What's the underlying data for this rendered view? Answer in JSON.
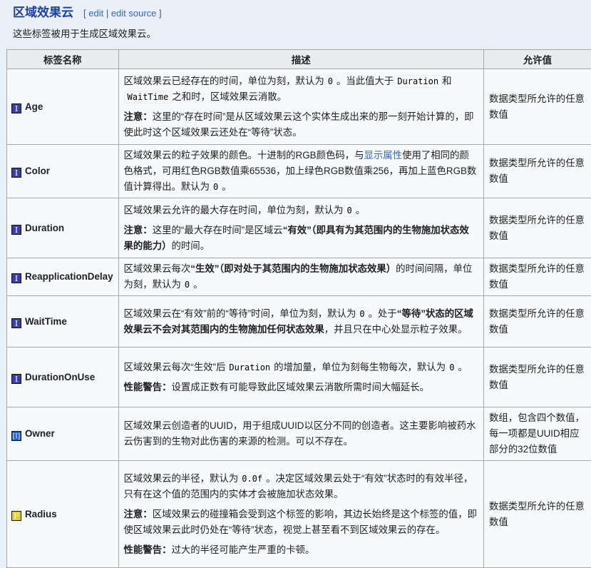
{
  "heading": {
    "title": "区域效果云",
    "edit_open": "[ ",
    "edit": "edit",
    "sep": " | ",
    "edit_source": "edit source",
    "edit_close": " ]"
  },
  "intro": "这些标签被用于生成区域效果云。",
  "table": {
    "headers": [
      "标签名称",
      "描述",
      "允许值"
    ],
    "rows": [
      {
        "icon": "int",
        "icon_glyph": "I",
        "name": "Age",
        "allowed": "数据类型所允许的任意数值",
        "desc": [
          [
            {
              "t": "区域效果云已经存在的时间，单位为刻，默认为"
            },
            {
              "code": "0"
            },
            {
              "t": "。当此值大于"
            },
            {
              "code": "Duration"
            },
            {
              "t": "和"
            },
            {
              "code": "WaitTime"
            },
            {
              "t": "之和时，区域效果云消散。"
            }
          ],
          [
            {
              "b": "注意："
            },
            {
              "t": "这里的“存在时间”是从区域效果云这个实体生成出来的那一刻开始计算的，即使此时这个区域效果云还处在“等待”状态。"
            }
          ]
        ]
      },
      {
        "icon": "int",
        "icon_glyph": "I",
        "name": "Color",
        "allowed": "数据类型所允许的任意数值",
        "desc": [
          [
            {
              "t": "区域效果云的粒子效果的颜色。十进制的RGB颜色码，与"
            },
            {
              "a": "显示属性"
            },
            {
              "t": "使用了相同的颜色格式，可用红色RGB数值乘65536，加上绿色RGB数值乘256，再加上蓝色RGB数值计算得出。默认为"
            },
            {
              "code": "0"
            },
            {
              "t": "。"
            }
          ]
        ]
      },
      {
        "icon": "int",
        "icon_glyph": "I",
        "name": "Duration",
        "allowed": "数据类型所允许的任意数值",
        "desc": [
          [
            {
              "t": "区域效果云允许的最大存在时间，单位为刻，默认为"
            },
            {
              "code": "0"
            },
            {
              "t": "。"
            }
          ],
          [
            {
              "b": "注意："
            },
            {
              "t": "这里的“最大存在时间”是区域云"
            },
            {
              "b": "“有效”（即具有为其范围内的生物施加状态效果的能力）"
            },
            {
              "t": "的时间。"
            }
          ]
        ]
      },
      {
        "icon": "int",
        "icon_glyph": "I",
        "name": "ReapplicationDelay",
        "allowed": "数据类型所允许的任意数值",
        "desc": [
          [
            {
              "t": "区域效果云每次"
            },
            {
              "b": "“生效”（即对处于其范围内的生物施加状态效果）"
            },
            {
              "t": "的时间间隔，单位为刻，默认为"
            },
            {
              "code": "0"
            },
            {
              "t": "。"
            }
          ]
        ]
      },
      {
        "icon": "int",
        "icon_glyph": "I",
        "name": "WaitTime",
        "allowed": "数据类型所允许的任意数值",
        "desc": [
          [
            {
              "t": "区域效果云在“有效”前的“等待”时间，单位为刻，默认为"
            },
            {
              "code": "0"
            },
            {
              "t": "。处于"
            },
            {
              "b": "“等待”状态的区域效果云不会对其范围内的生物施加任何状态效果"
            },
            {
              "t": "，并且只在中心处显示粒子效果。"
            }
          ]
        ]
      },
      {
        "icon": "int",
        "icon_glyph": "I",
        "name": "DurationOnUse",
        "allowed": "数据类型所允许的任意数值",
        "desc": [
          [
            {
              "t": "区域效果云每次“生效”后"
            },
            {
              "code": "Duration"
            },
            {
              "t": "的增加量，单位为刻每生物每次，默认为"
            },
            {
              "code": "0"
            },
            {
              "t": "。"
            }
          ],
          [
            {
              "b": "性能警告："
            },
            {
              "t": "设置成正数有可能导致此区域效果云消散所需时间大幅延长。"
            }
          ]
        ]
      },
      {
        "icon": "arr",
        "icon_glyph": "[I]",
        "name": "Owner",
        "allowed": "数组，包含四个数值，每一项都是UUID相应部分的32位数值",
        "desc": [
          [
            {
              "t": "区域效果云创造者的UUID，用于组成UUID以区分不同的创造者。这主要影响被药水云伤害到的生物对此伤害的来源的检测。可以不存在。"
            }
          ]
        ]
      },
      {
        "icon": "flt",
        "icon_glyph": "F",
        "name": "Radius",
        "allowed": "数据类型所允许的任意数值",
        "desc": [
          [
            {
              "t": "区域效果云的半径，默认为"
            },
            {
              "code": "0.0f"
            },
            {
              "t": "。决定区域效果云处于“有效”状态时的有效半径，只有在这个值的范围内的实体才会被施加状态效果。"
            }
          ],
          [
            {
              "b": "注意："
            },
            {
              "t": "区域效果云的碰撞箱会受到这个标签的影响，其边长始终是这个标签的值，即使区域效果云此时仍处在“等待”状态，视觉上甚至看不到区域效果云的存在。"
            }
          ],
          [
            {
              "b": "性能警告："
            },
            {
              "t": "过大的半径可能产生严重的卡顿。"
            }
          ]
        ]
      }
    ]
  }
}
